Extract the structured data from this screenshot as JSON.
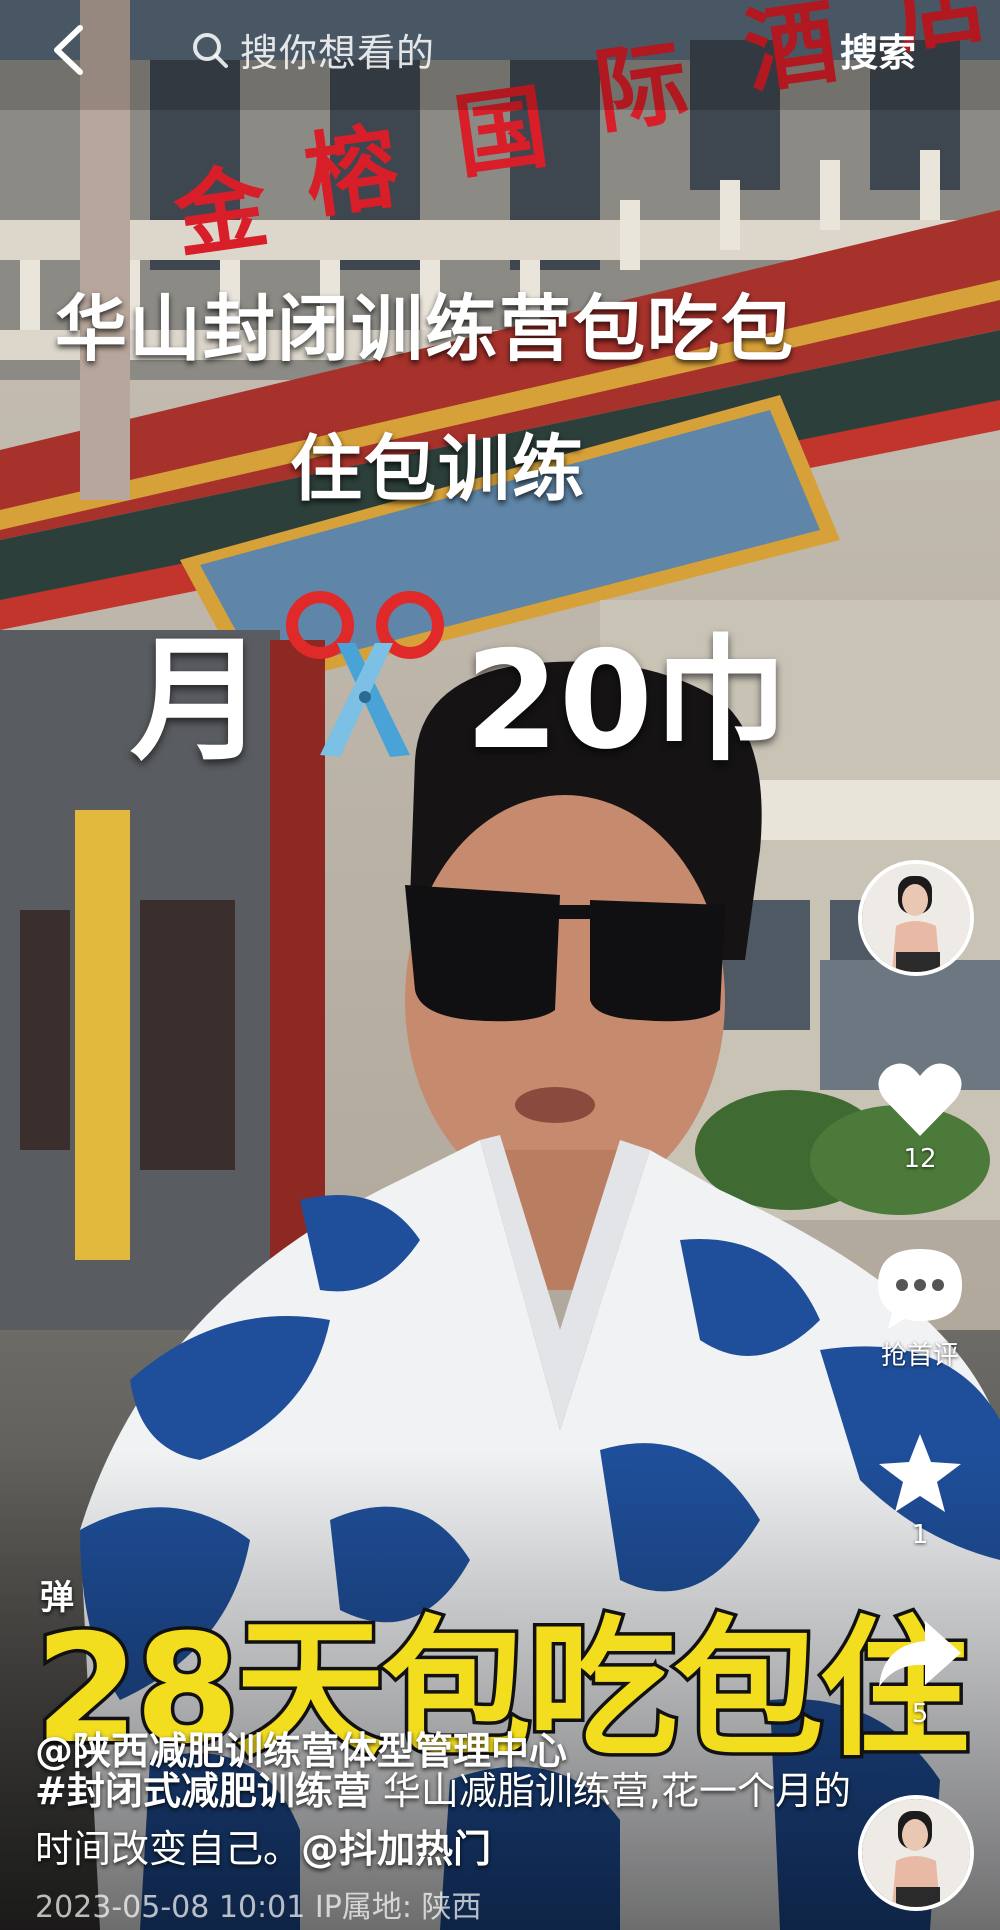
{
  "search": {
    "placeholder": "搜你想看的",
    "button": "搜索"
  },
  "video": {
    "caption_line1": "华山封闭训练营包吃包",
    "caption_line2": "住包训练",
    "price_prefix": "月",
    "price_value": "20巾",
    "overlay_text": "28天包吃包住",
    "building_sign": "金榕国际酒店",
    "danmu_toggle": "弹"
  },
  "actions": {
    "like_count": "12",
    "comment_label": "抢首评",
    "favorite_count": "1",
    "share_count": "5"
  },
  "post": {
    "author": "@陕西减肥训练营体型管理中心",
    "hashtag": "#封闭式减肥训练营",
    "desc_rest": " 华山减脂训练营,花一个月的时间改变自己。",
    "mention": "@抖加热门",
    "date": "2023-05-08 10:01",
    "ip_label": "IP属地:",
    "ip_location": "陕西"
  },
  "colors": {
    "overlay_yellow": "#f3dd1f",
    "sign_red": "#d81e28",
    "shirt_blue": "#1f4f9a"
  },
  "icons": [
    "back-icon",
    "search-icon",
    "heart-icon",
    "comment-icon",
    "star-icon",
    "share-icon",
    "scissors-icon"
  ]
}
